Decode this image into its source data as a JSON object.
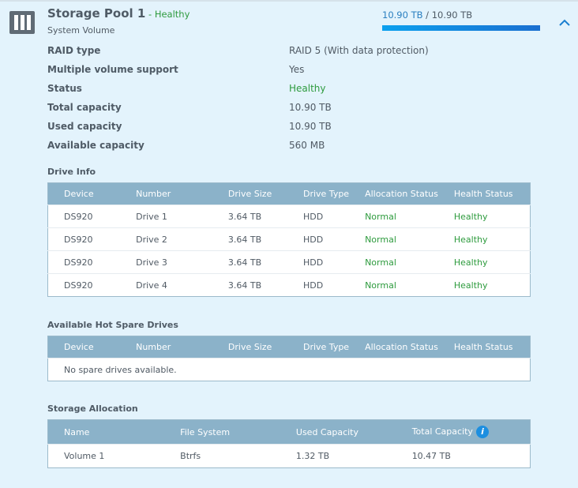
{
  "pool": {
    "title": "Storage Pool 1",
    "status_sep": " - ",
    "status": "Healthy",
    "subtitle": "System Volume",
    "used": "10.90 TB",
    "sep": " / ",
    "total": "10.90 TB",
    "usage_percent": 100,
    "accent": "#0b9aea",
    "icon": "storage-pool-icon"
  },
  "details": [
    {
      "label": "RAID type",
      "value": "RAID 5 (With data protection)"
    },
    {
      "label": "Multiple volume support",
      "value": "Yes"
    },
    {
      "label": "Status",
      "value": "Healthy"
    },
    {
      "label": "Total capacity",
      "value": "10.90 TB"
    },
    {
      "label": "Used capacity",
      "value": "10.90 TB"
    },
    {
      "label": "Available capacity",
      "value": "560 MB"
    }
  ],
  "drive_info": {
    "title": "Drive Info",
    "columns": [
      "Device",
      "Number",
      "Drive Size",
      "Drive Type",
      "Allocation Status",
      "Health Status"
    ],
    "rows": [
      [
        "DS920",
        "Drive 1",
        "3.64 TB",
        "HDD",
        "Normal",
        "Healthy"
      ],
      [
        "DS920",
        "Drive 2",
        "3.64 TB",
        "HDD",
        "Normal",
        "Healthy"
      ],
      [
        "DS920",
        "Drive 3",
        "3.64 TB",
        "HDD",
        "Normal",
        "Healthy"
      ],
      [
        "DS920",
        "Drive 4",
        "3.64 TB",
        "HDD",
        "Normal",
        "Healthy"
      ]
    ]
  },
  "hot_spare": {
    "title": "Available Hot Spare Drives",
    "columns": [
      "Device",
      "Number",
      "Drive Size",
      "Drive Type",
      "Allocation Status",
      "Health Status"
    ],
    "empty": "No spare drives available."
  },
  "allocation": {
    "title": "Storage Allocation",
    "columns": [
      "Name",
      "File System",
      "Used Capacity",
      "Total Capacity"
    ],
    "rows": [
      [
        "Volume 1",
        "Btrfs",
        "1.32 TB",
        "10.47 TB"
      ]
    ]
  }
}
